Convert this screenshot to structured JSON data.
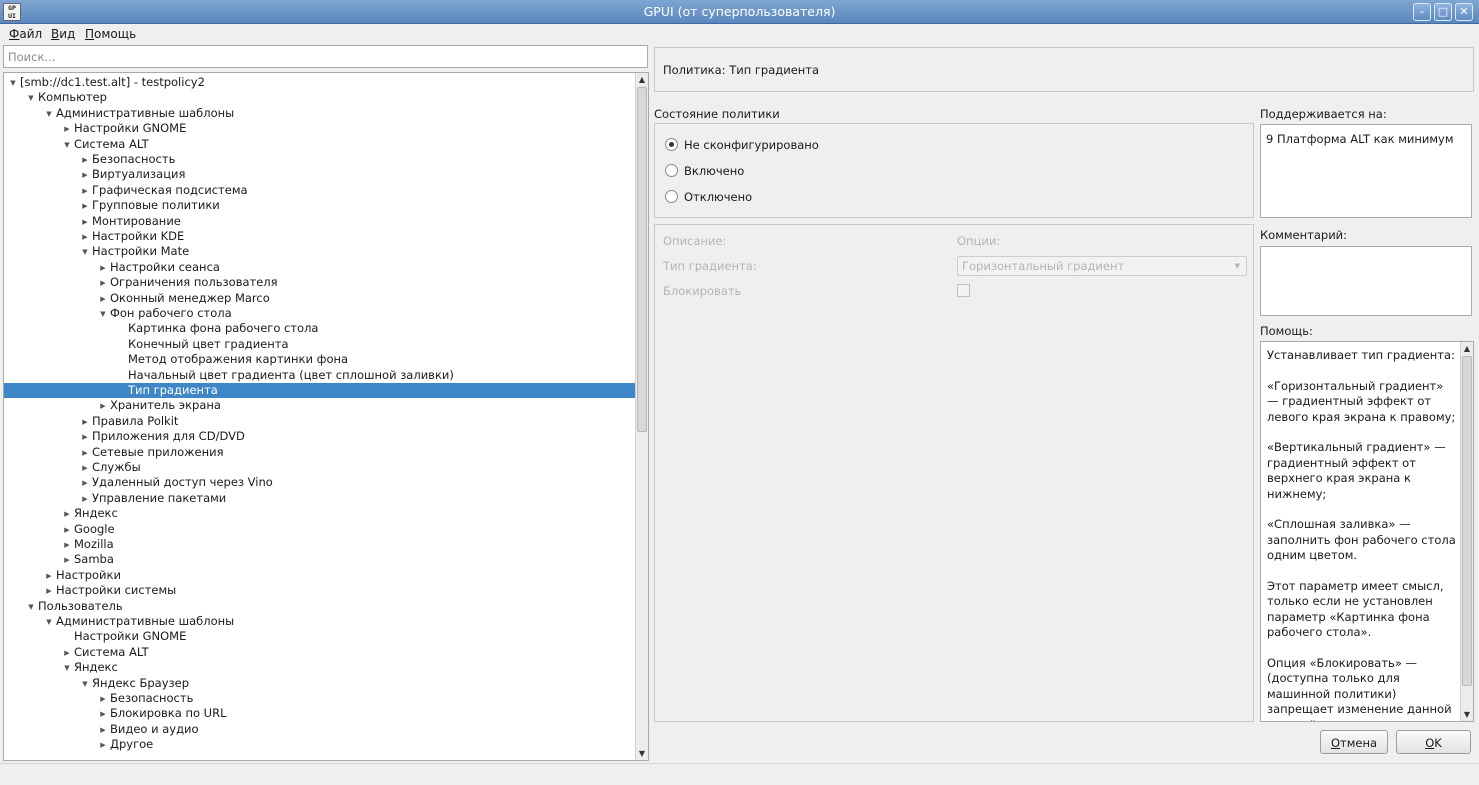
{
  "window": {
    "icon_text": "GP\nUI",
    "title": "GPUI (от суперпользователя)",
    "buttons": {
      "minimize": "–",
      "maximize": "□",
      "close": "✕"
    }
  },
  "menu": [
    "Файл",
    "Вид",
    "Помощь"
  ],
  "search": {
    "placeholder": "Поиск..."
  },
  "tree": [
    {
      "depth": 0,
      "arrow": "down",
      "label": "[smb://dc1.test.alt] - testpolicy2"
    },
    {
      "depth": 1,
      "arrow": "down",
      "label": "Компьютер"
    },
    {
      "depth": 2,
      "arrow": "down",
      "label": "Административные шаблоны"
    },
    {
      "depth": 3,
      "arrow": "right",
      "label": "Настройки GNOME"
    },
    {
      "depth": 3,
      "arrow": "down",
      "label": "Система ALT"
    },
    {
      "depth": 4,
      "arrow": "right",
      "label": "Безопасность"
    },
    {
      "depth": 4,
      "arrow": "right",
      "label": "Виртуализация"
    },
    {
      "depth": 4,
      "arrow": "right",
      "label": "Графическая подсистема"
    },
    {
      "depth": 4,
      "arrow": "right",
      "label": "Групповые политики"
    },
    {
      "depth": 4,
      "arrow": "right",
      "label": "Монтирование"
    },
    {
      "depth": 4,
      "arrow": "right",
      "label": "Настройки KDE"
    },
    {
      "depth": 4,
      "arrow": "down",
      "label": "Настройки Mate"
    },
    {
      "depth": 5,
      "arrow": "right",
      "label": "Настройки сеанса"
    },
    {
      "depth": 5,
      "arrow": "right",
      "label": "Ограничения пользователя"
    },
    {
      "depth": 5,
      "arrow": "right",
      "label": "Оконный менеджер Marco"
    },
    {
      "depth": 5,
      "arrow": "down",
      "label": "Фон рабочего стола"
    },
    {
      "depth": 6,
      "arrow": "none",
      "label": "Картинка фона рабочего стола"
    },
    {
      "depth": 6,
      "arrow": "none",
      "label": "Конечный цвет градиента"
    },
    {
      "depth": 6,
      "arrow": "none",
      "label": "Метод отображения картинки фона"
    },
    {
      "depth": 6,
      "arrow": "none",
      "label": "Начальный цвет градиента (цвет сплошной заливки)"
    },
    {
      "depth": 6,
      "arrow": "none",
      "label": "Тип градиента",
      "selected": true
    },
    {
      "depth": 5,
      "arrow": "right",
      "label": "Хранитель экрана"
    },
    {
      "depth": 4,
      "arrow": "right",
      "label": "Правила Polkit"
    },
    {
      "depth": 4,
      "arrow": "right",
      "label": "Приложения для CD/DVD"
    },
    {
      "depth": 4,
      "arrow": "right",
      "label": "Сетевые приложения"
    },
    {
      "depth": 4,
      "arrow": "right",
      "label": "Службы"
    },
    {
      "depth": 4,
      "arrow": "right",
      "label": "Удаленный доступ через Vino"
    },
    {
      "depth": 4,
      "arrow": "right",
      "label": "Управление пакетами"
    },
    {
      "depth": 3,
      "arrow": "right",
      "label": "Яндекс"
    },
    {
      "depth": 3,
      "arrow": "right",
      "label": "Google"
    },
    {
      "depth": 3,
      "arrow": "right",
      "label": "Mozilla"
    },
    {
      "depth": 3,
      "arrow": "right",
      "label": "Samba"
    },
    {
      "depth": 2,
      "arrow": "right",
      "label": "Настройки"
    },
    {
      "depth": 2,
      "arrow": "right",
      "label": "Настройки системы"
    },
    {
      "depth": 1,
      "arrow": "down",
      "label": "Пользователь"
    },
    {
      "depth": 2,
      "arrow": "down",
      "label": "Административные шаблоны"
    },
    {
      "depth": 3,
      "arrow": "none",
      "label": "Настройки GNOME"
    },
    {
      "depth": 3,
      "arrow": "right",
      "label": "Система ALT"
    },
    {
      "depth": 3,
      "arrow": "down",
      "label": "Яндекс"
    },
    {
      "depth": 4,
      "arrow": "down",
      "label": "Яндекс Браузер"
    },
    {
      "depth": 5,
      "arrow": "right",
      "label": "Безопасность"
    },
    {
      "depth": 5,
      "arrow": "right",
      "label": "Блокировка по URL"
    },
    {
      "depth": 5,
      "arrow": "right",
      "label": "Видео и аудио"
    },
    {
      "depth": 5,
      "arrow": "right",
      "label": "Другое"
    }
  ],
  "policy": {
    "title": "Политика: Тип градиента",
    "state_label": "Состояние политики",
    "states": [
      {
        "label": "Не сконфигурировано",
        "checked": true
      },
      {
        "label": "Включено",
        "checked": false
      },
      {
        "label": "Отключено",
        "checked": false
      }
    ],
    "description_label": "Описание:",
    "options_label": "Опции:",
    "gradient_type_label": "Тип градиента:",
    "gradient_type_value": "Горизонтальный градиент",
    "lock_label": "Блокировать"
  },
  "supported": {
    "label": "Поддерживается на:",
    "value": "9 Платформа ALT как минимум"
  },
  "comment": {
    "label": "Комментарий:",
    "value": ""
  },
  "help": {
    "label": "Помощь:",
    "paragraphs": [
      "Устанавливает тип градиента:",
      "«Горизонтальный градиент» — градиентный эффект от левого края экрана к правому;",
      "«Вертикальный градиент» — градиентный эффект от верхнего края экрана к нижнему;",
      "«Сплошная заливка» — заполнить фон рабочего стола одним цветом.",
      "Этот параметр имеет смысл, только если не установлен параметр «Картинка фона рабочего стола».",
      "Опция «Блокировать» — (доступна только для машинной политики) запрещает изменение данной настройки пользователем. Блокировка политики делает её приоритетнее аналогичной политики для пользователя."
    ]
  },
  "buttons": {
    "cancel": "Отмена",
    "ok": "OK"
  },
  "scroll_glyphs": {
    "up": "▲",
    "down": "▼"
  },
  "colors": {
    "selection": "#3f86c7",
    "titlebar": "#6a95c9"
  }
}
